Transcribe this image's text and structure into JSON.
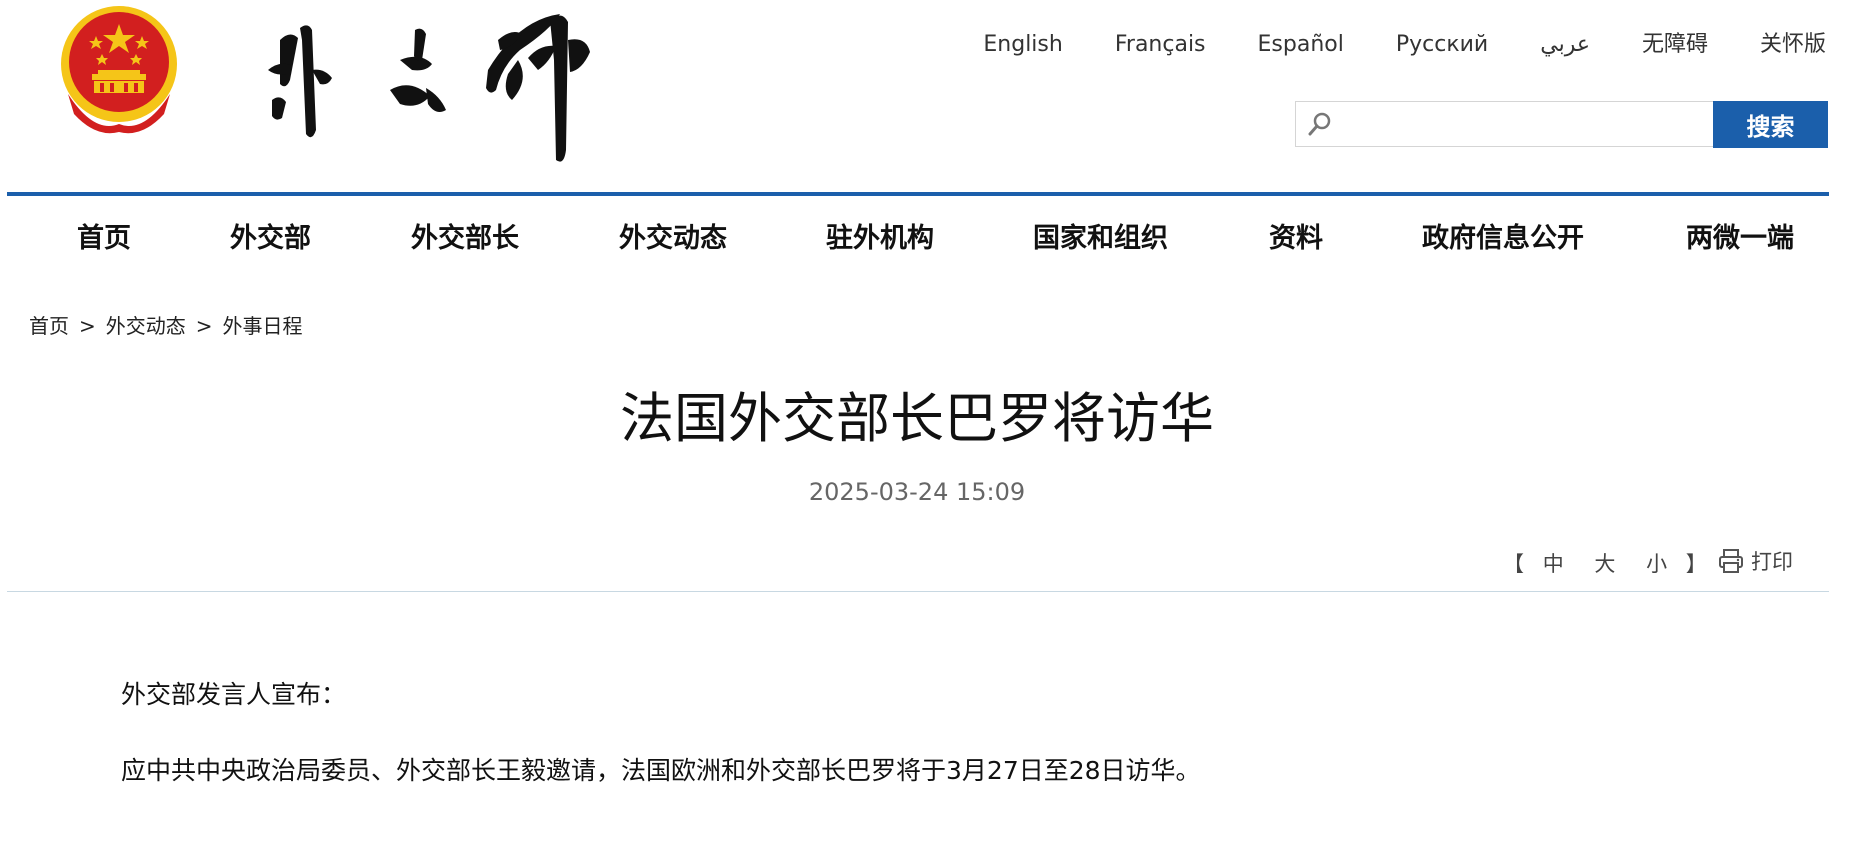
{
  "logo": {
    "emblem_colors": {
      "red": "#d21f1f",
      "gold": "#f5c518"
    },
    "calligraphy_text": "外交部"
  },
  "languages": [
    "English",
    "Français",
    "Español",
    "Русский",
    "عربي",
    "无障碍",
    "关怀版"
  ],
  "search": {
    "placeholder": "",
    "button_label": "搜索"
  },
  "nav": [
    "首页",
    "外交部",
    "外交部长",
    "外交动态",
    "驻外机构",
    "国家和组织",
    "资料",
    "政府信息公开",
    "两微一端"
  ],
  "breadcrumb": [
    "首页",
    "外交动态",
    "外事日程"
  ],
  "breadcrumb_separator": ">",
  "article": {
    "title": "法国外交部长巴罗将访华",
    "date": "2025-03-24 15:09",
    "font_tools": {
      "open": "【",
      "large": "中",
      "medium": "大",
      "small": "小",
      "close": "】"
    },
    "print_label": "打印",
    "paragraphs": [
      "外交部发言人宣布：",
      "应中共中央政治局委员、外交部长王毅邀请，法国欧洲和外交部长巴罗将于3月27日至28日访华。"
    ]
  },
  "colors": {
    "brand_blue": "#1b5fab",
    "rule_light": "#c8d8e2"
  }
}
